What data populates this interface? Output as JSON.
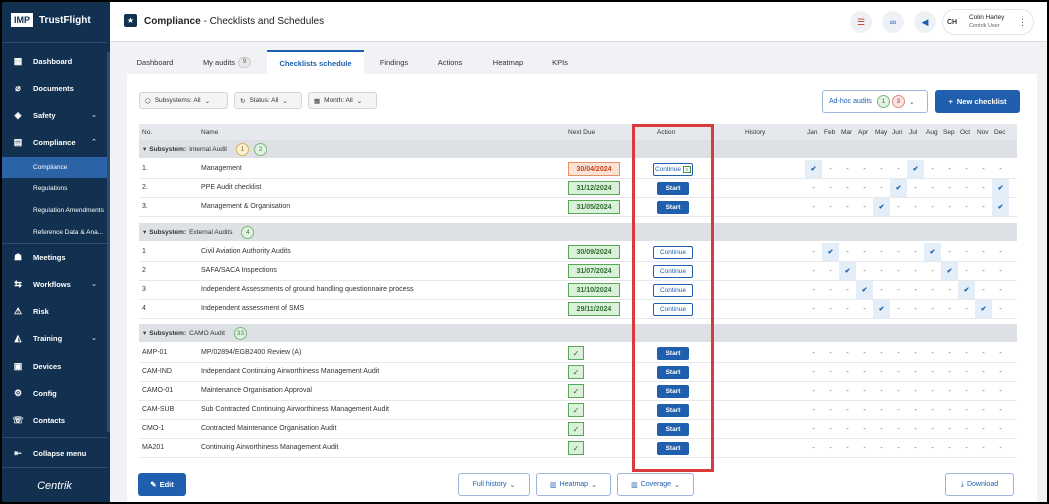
{
  "brand": {
    "logo_box": "IMP",
    "name": "TrustFlight",
    "footer": "Centrik"
  },
  "header": {
    "title_bold": "Compliance",
    "title_rest": "- Checklists and Schedules",
    "user_initials": "CH",
    "user_name": "Colin Harley",
    "user_role": "Centrik User"
  },
  "nav": {
    "dashboard": "Dashboard",
    "documents": "Documents",
    "safety": "Safety",
    "compliance": "Compliance",
    "sub_compliance": "Compliance",
    "sub_regulations": "Regulations",
    "sub_reg_amend": "Regulation Amendments",
    "sub_ref_data": "Reference Data & Ana...",
    "meetings": "Meetings",
    "workflows": "Workflows",
    "risk": "Risk",
    "training": "Training",
    "devices": "Devices",
    "config": "Config",
    "contacts": "Contacts",
    "collapse": "Collapse menu"
  },
  "tabs": {
    "dashboard": "Dashboard",
    "my_audits": "My audits",
    "my_audits_count": "9",
    "checklists": "Checklists schedule",
    "findings": "Findings",
    "actions": "Actions",
    "heatmap": "Heatmap",
    "kpis": "KPIs"
  },
  "filters": {
    "subsystems": "Subsystems: All",
    "status": "Status: All",
    "month": "Month: All"
  },
  "adhoc": {
    "label": "Ad-hoc audits",
    "green": "1",
    "red": "3"
  },
  "new_checklist": "New checklist",
  "columns": {
    "no": "No.",
    "name": "Name",
    "next_due": "Next Due",
    "action": "Action",
    "history": "History"
  },
  "months": [
    "Jan",
    "Feb",
    "Mar",
    "Apr",
    "May",
    "Jun",
    "Jul",
    "Aug",
    "Sep",
    "Oct",
    "Nov",
    "Dec"
  ],
  "groups": [
    {
      "label_prefix": "Subsystem:",
      "label": "Internal Audit",
      "badges": [
        "1",
        "2"
      ],
      "badge_styles": [
        "yel",
        "green"
      ]
    },
    {
      "label_prefix": "Subsystem:",
      "label": "External Audits",
      "badges": [
        "4"
      ],
      "badge_styles": [
        "green"
      ]
    },
    {
      "label_prefix": "Subsystem:",
      "label": "CAMO Audit",
      "badges": [
        "33"
      ],
      "badge_styles": [
        "green"
      ]
    }
  ],
  "rows": [
    {
      "no": "1.",
      "name": "Management",
      "due": "30/04/2024",
      "due_style": "red",
      "action": "Continue",
      "action_icon": true,
      "months_checked": [
        1,
        7
      ]
    },
    {
      "no": "2.",
      "name": "PPE Audit checklist",
      "due": "31/12/2024",
      "due_style": "green",
      "action": "Start",
      "months_checked": [
        6,
        12
      ]
    },
    {
      "no": "3.",
      "name": "Management & Organisation",
      "due": "31/05/2024",
      "due_style": "green",
      "action": "Start",
      "months_checked": [
        5,
        12
      ]
    },
    {
      "no": "1",
      "name": "Civil Aviation Authority Audits",
      "due": "30/09/2024",
      "due_style": "green",
      "action": "Continue",
      "months_checked": [
        2,
        8
      ]
    },
    {
      "no": "2",
      "name": "SAFA/SACA Inspections",
      "due": "31/07/2024",
      "due_style": "green",
      "action": "Continue",
      "months_checked": [
        3,
        9
      ]
    },
    {
      "no": "3",
      "name": "Independent Assessments of ground handling questionnaire process",
      "due": "31/10/2024",
      "due_style": "green",
      "action": "Continue",
      "months_checked": [
        4,
        10
      ]
    },
    {
      "no": "4",
      "name": "Independent assessment of SMS",
      "due": "29/11/2024",
      "due_style": "green",
      "action": "Continue",
      "months_checked": [
        5,
        11
      ]
    },
    {
      "no": "AMP-01",
      "name": "MP/02894/EGB2400 Review (A)",
      "due": "",
      "due_style": "check",
      "action": "Start",
      "months_checked": []
    },
    {
      "no": "CAM-IND",
      "name": "Independant Continuing Airworthiness Management Audit",
      "due": "",
      "due_style": "check",
      "action": "Start",
      "months_checked": []
    },
    {
      "no": "CAMO-01",
      "name": "Maintenance Organisation Approval",
      "due": "",
      "due_style": "check",
      "action": "Start",
      "months_checked": []
    },
    {
      "no": "CAM-SUB",
      "name": "Sub Contracted Continuing Airworthiness Management Audit",
      "due": "",
      "due_style": "check",
      "action": "Start",
      "months_checked": []
    },
    {
      "no": "CMO-1",
      "name": "Contracted Maintenance Organisation Audit",
      "due": "",
      "due_style": "check",
      "action": "Start",
      "months_checked": []
    },
    {
      "no": "MA201",
      "name": "Continuing Airworthiness Management Audit",
      "due": "",
      "due_style": "check",
      "action": "Start",
      "months_checked": []
    }
  ],
  "footer": {
    "edit": "Edit",
    "full_history": "Full history",
    "heatmap": "Heatmap",
    "coverage": "Coverage",
    "download": "Download"
  },
  "colors": {
    "sidebar": "#123150",
    "accent": "#1f5fae",
    "highlight_box": "#d93a3a"
  }
}
